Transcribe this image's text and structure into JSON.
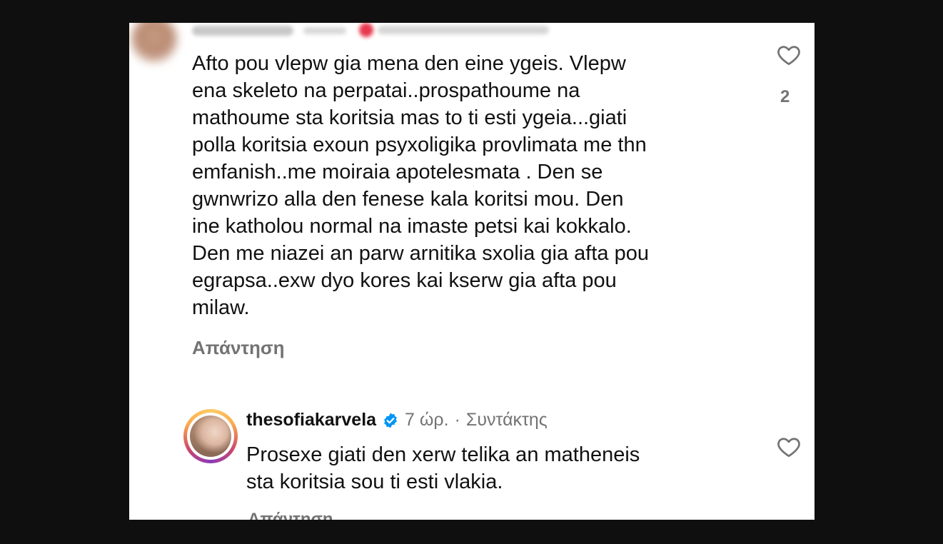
{
  "comment": {
    "text": "Afto pou vlepw gia mena den eine ygeis. Vlepw\nena skeleto na perpatai..prospathoume na\nmathoume sta koritsia mas to ti esti ygeia...giati\npolla koritsia exoun psyxoligika provlimata me thn\nemfanish..me moiraia apotelesmata . Den se\ngwnwrizo alla den fenese kala koritsi mou. Den\nine katholou normal  na imaste petsi kai kokkalo.\nDen me niazei an parw arnitika sxolia gia afta pou\negrapsa..exw dyo kores kai kserw gia afta pou\nmilaw.",
    "reply_label": "Απάντηση",
    "like_count": "2",
    "like_icon": "heart-outline-icon"
  },
  "reply": {
    "username": "thesofiakarvela",
    "verified_icon": "verified-badge-icon",
    "time": "7 ώρ.",
    "separator": "·",
    "role": "Συντάκτης",
    "text": "Prosexe giati den xerw telika an matheneis\nsta koritsia sou ti esti vlakia.",
    "like_icon": "heart-outline-icon"
  },
  "colors": {
    "background": "#0f0f0f",
    "card": "#ffffff",
    "text": "#111111",
    "muted": "#737373",
    "verified": "#0095f6"
  }
}
